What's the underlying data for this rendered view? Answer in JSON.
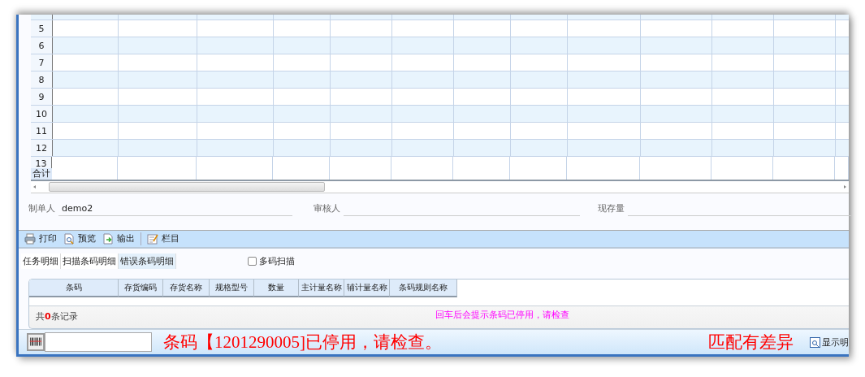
{
  "grid": {
    "rows": [
      {
        "number": "5"
      },
      {
        "number": "6"
      },
      {
        "number": "7"
      },
      {
        "number": "8"
      },
      {
        "number": "9"
      },
      {
        "number": "10"
      },
      {
        "number": "11"
      },
      {
        "number": "12"
      },
      {
        "number": "13"
      }
    ],
    "total_label": "合计"
  },
  "form": [
    {
      "label": "制单人",
      "value": "demo2"
    },
    {
      "label": "审核人"
    },
    {
      "label": "现存量"
    }
  ],
  "toolbar": [
    {
      "kind": "print",
      "label": "打印"
    },
    {
      "kind": "preview",
      "label": "预览"
    },
    {
      "kind": "export",
      "label": "输出"
    },
    {
      "kind": "columns",
      "label": "栏目"
    }
  ],
  "tabs": [
    {
      "label": "任务明细",
      "selected": false
    },
    {
      "label": "扫描条码明细",
      "selected": false
    },
    {
      "label": "错误条码明细",
      "selected": true
    }
  ],
  "multi_scan": {
    "label": "多码扫描",
    "checked": false
  },
  "detail_table": {
    "columns": [
      "条码",
      "存货编码",
      "存货名称",
      "规格型号",
      "数量",
      "主计量名称",
      "辅计量名称",
      "条码规则名称"
    ],
    "record_count": "共**0**条记录",
    "note": "回车后会提示条码已停用，请检查"
  },
  "status_bar": {
    "message": "条码【1201290005]已停用，请检查。",
    "result": "匹配有差异",
    "show_button": "显示明"
  }
}
